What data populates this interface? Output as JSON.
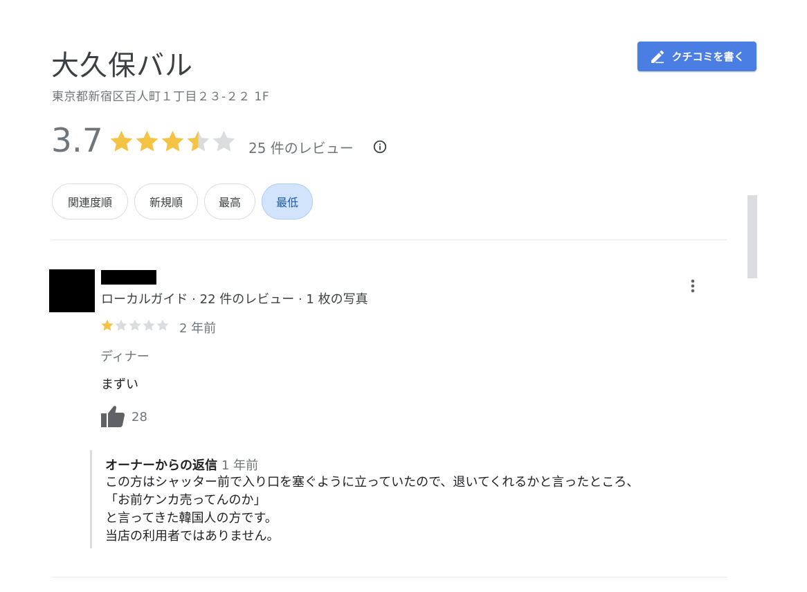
{
  "place": {
    "title": "大久保バル",
    "address": "東京都新宿区百人町１丁目２３-２２ 1F"
  },
  "write_review": {
    "label": "クチコミを書く",
    "icon": "pencil-icon",
    "color": "#4a7ee3"
  },
  "summary": {
    "rating": "3.7",
    "rating_value": 3.7,
    "review_count": "25 件のレビュー",
    "star_color": "#f4c343",
    "empty_star_color": "#dadce0"
  },
  "sort_chips": [
    {
      "label": "関連度順",
      "active": false
    },
    {
      "label": "新規順",
      "active": false
    },
    {
      "label": "最高",
      "active": false
    },
    {
      "label": "最低",
      "active": true
    }
  ],
  "review": {
    "reviewer_meta": "ローカルガイド · 22 件のレビュー · 1 枚の写真",
    "rating": 1,
    "date": "2 年前",
    "tag": "ディナー",
    "text": "まずい",
    "likes": "28",
    "owner_reply": {
      "author": "オーナーからの返信",
      "date": "1 年前",
      "text": "この方はシャッター前で入り口を塞ぐように立っていたので、退いてくれるかと言ったところ、\n「お前ケンカ売ってんのか」\nと言ってきた韓国人の方です。\n当店の利用者ではありません。"
    }
  }
}
